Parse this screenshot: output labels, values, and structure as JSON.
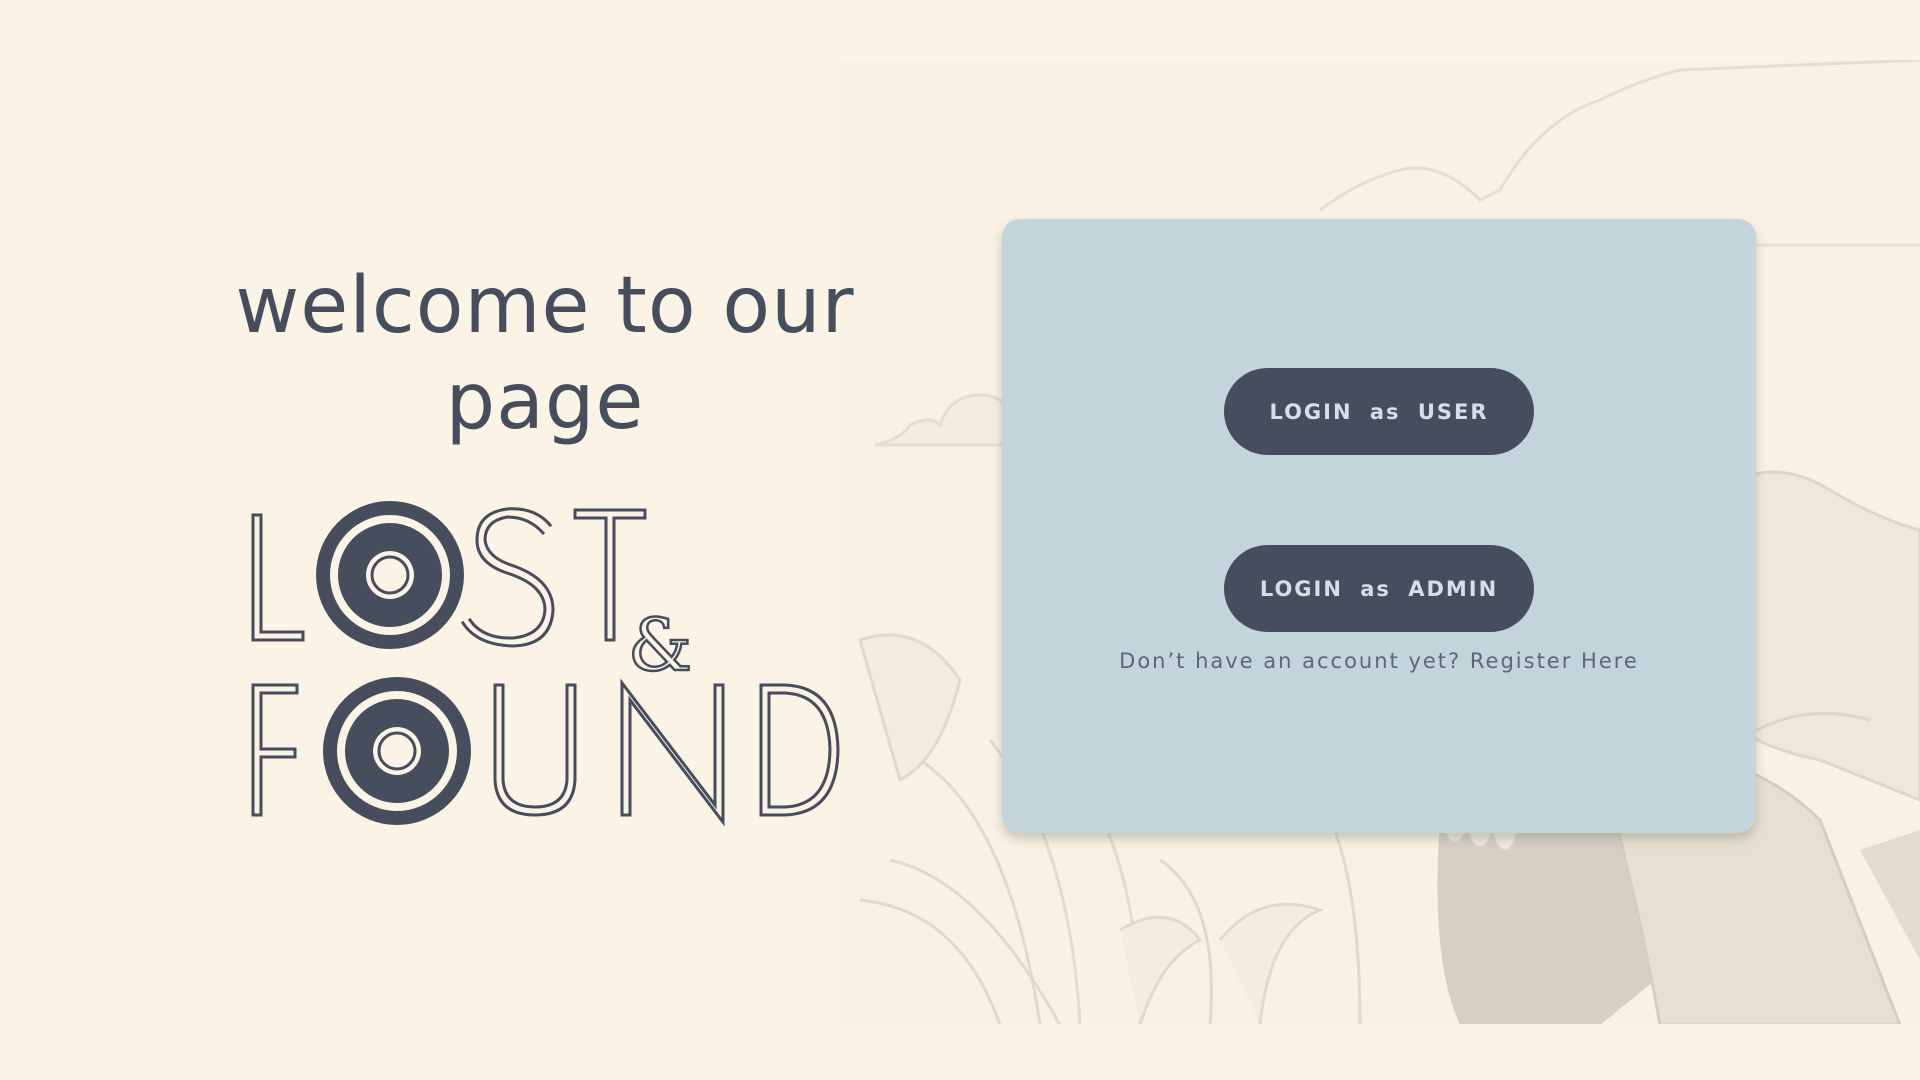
{
  "welcome": {
    "line1": "welcome to our",
    "line2": "page"
  },
  "logo": {
    "word1": "LOST",
    "ampersand": "&",
    "word2": "FOUND"
  },
  "login_card": {
    "user_button_label": "LOGIN as USER",
    "admin_button_label": "LOGIN as ADMIN",
    "register_prompt": "Don’t have an account yet?",
    "register_link": "Register Here"
  },
  "colors": {
    "background": "#faf3e6",
    "card": "#c3d4da",
    "button": "#464d5d",
    "button_text": "#d3e1e6",
    "text_dark": "#464d5d"
  },
  "icons": [
    "background-illustration"
  ]
}
